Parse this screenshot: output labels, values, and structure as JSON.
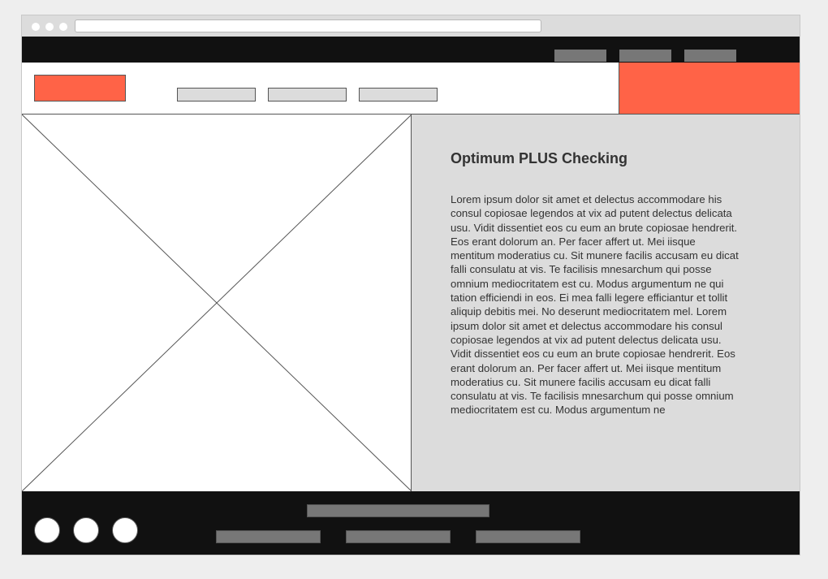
{
  "browser": {
    "address_bar": ""
  },
  "header": {
    "brand_color": "#ff6347"
  },
  "content": {
    "title": "Optimum PLUS Checking",
    "body": "Lorem ipsum dolor sit amet et delectus accommodare his consul copiosae legendos at vix ad putent delectus delicata usu. Vidit dissentiet eos cu eum an brute copiosae hendrerit. Eos erant dolorum an. Per facer affert ut. Mei iisque mentitum moderatius cu. Sit munere facilis accusam eu dicat falli consulatu at vis. Te facilisis mnesarchum qui posse omnium mediocritatem est cu. Modus argumentum ne qui tation efficiendi in eos. Ei mea falli legere efficiantur et tollit aliquip debitis mei. No deserunt mediocritatem mel. Lorem ipsum dolor sit amet et delectus accommodare his consul copiosae legendos at vix ad putent delectus delicata usu. Vidit dissentiet eos cu eum an brute copiosae hendrerit. Eos erant dolorum an. Per facer affert ut. Mei iisque mentitum moderatius cu. Sit munere facilis accusam eu dicat falli consulatu at vis. Te facilisis mnesarchum qui posse omnium mediocritatem est cu. Modus argumentum ne"
  },
  "icons": {
    "hero_image": "image-placeholder-icon",
    "social": [
      "social-icon",
      "social-icon",
      "social-icon"
    ]
  }
}
